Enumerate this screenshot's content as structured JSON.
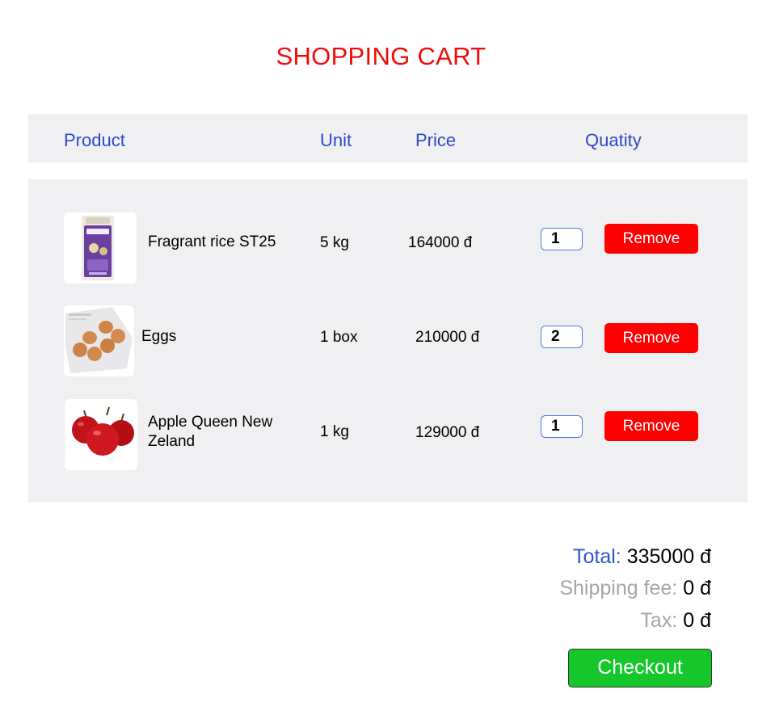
{
  "page": {
    "title": "SHOPPING CART"
  },
  "table": {
    "headers": {
      "product": "Product",
      "unit": "Unit",
      "price": "Price",
      "quantity": "Quatity"
    },
    "items": [
      {
        "name": "Fragrant rice ST25",
        "unit": "5 kg",
        "price": "164000 đ",
        "quantity": "1",
        "remove_label": "Remove"
      },
      {
        "name": "Eggs",
        "unit": "1 box",
        "price": "210000 đ",
        "quantity": "2",
        "remove_label": "Remove"
      },
      {
        "name": "Apple Queen New Zeland",
        "unit": "1 kg",
        "price": "129000 đ",
        "quantity": "1",
        "remove_label": "Remove"
      }
    ]
  },
  "summary": {
    "total_label": "Total:",
    "total_value": "335000 đ",
    "shipping_label": "Shipping fee:",
    "shipping_value": "0 đ",
    "tax_label": "Tax:",
    "tax_value": "0 đ"
  },
  "checkout_label": "Checkout",
  "colors": {
    "title": "#f10c0c",
    "header_text": "#2e49c8",
    "panel_bg": "#f0eff1",
    "remove_bg": "#fd0101",
    "checkout_bg": "#15c72a"
  }
}
